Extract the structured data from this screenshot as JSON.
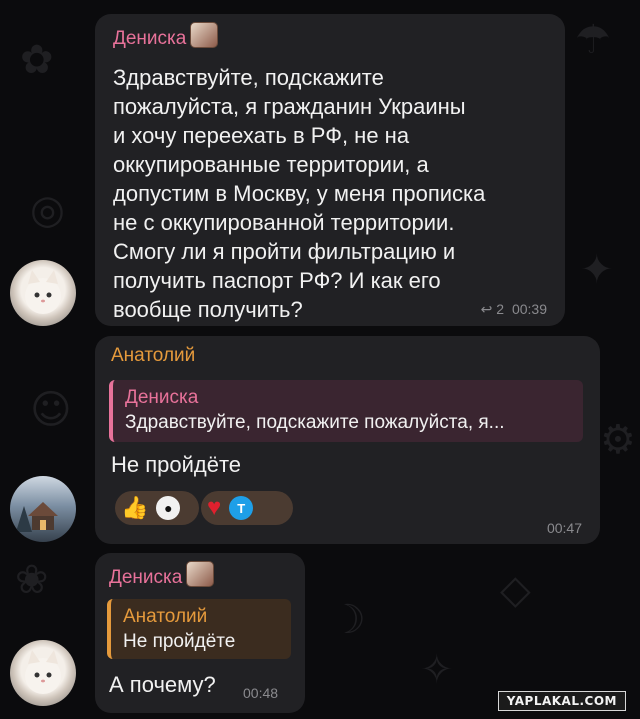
{
  "messages": [
    {
      "sender": "Дениска",
      "lines": [
        "Здравствуйте, подскажите",
        "пожалуйста, я гражданин Украины",
        "и хочу переехать в РФ, не на",
        "оккупированные территории, а",
        "допустим в Москву, у меня прописка",
        "не с оккупированной территории.",
        "Смогу ли я пройти фильтрацию и",
        "получить паспорт РФ? И как его",
        "вообще получить?"
      ],
      "reply_count": "2",
      "time": "00:39"
    },
    {
      "sender": "Анатолий",
      "quote": {
        "sender": "Дениска",
        "text": "Здравствуйте, подскажите пожалуйста, я..."
      },
      "text": "Не пройдёте",
      "reactions": [
        {
          "icon": "thumbs-up-icon",
          "glyph": "👍"
        },
        {
          "icon": "avatar-icon",
          "glyph": "●"
        },
        {
          "icon": "heart-icon",
          "glyph": "♥"
        },
        {
          "icon": "avatar-icon",
          "glyph": "T"
        }
      ],
      "time": "00:47"
    },
    {
      "sender": "Дениска",
      "quote": {
        "sender": "Анатолий",
        "text": "Не пройдёте"
      },
      "text": "А почему?",
      "time": "00:48"
    }
  ],
  "watermark": "YAPLAKAL.COM",
  "colors": {
    "background": "#0b0b0d",
    "bubble": "#212124",
    "pink_name": "#e8729a",
    "orange_name": "#e59a3c"
  }
}
